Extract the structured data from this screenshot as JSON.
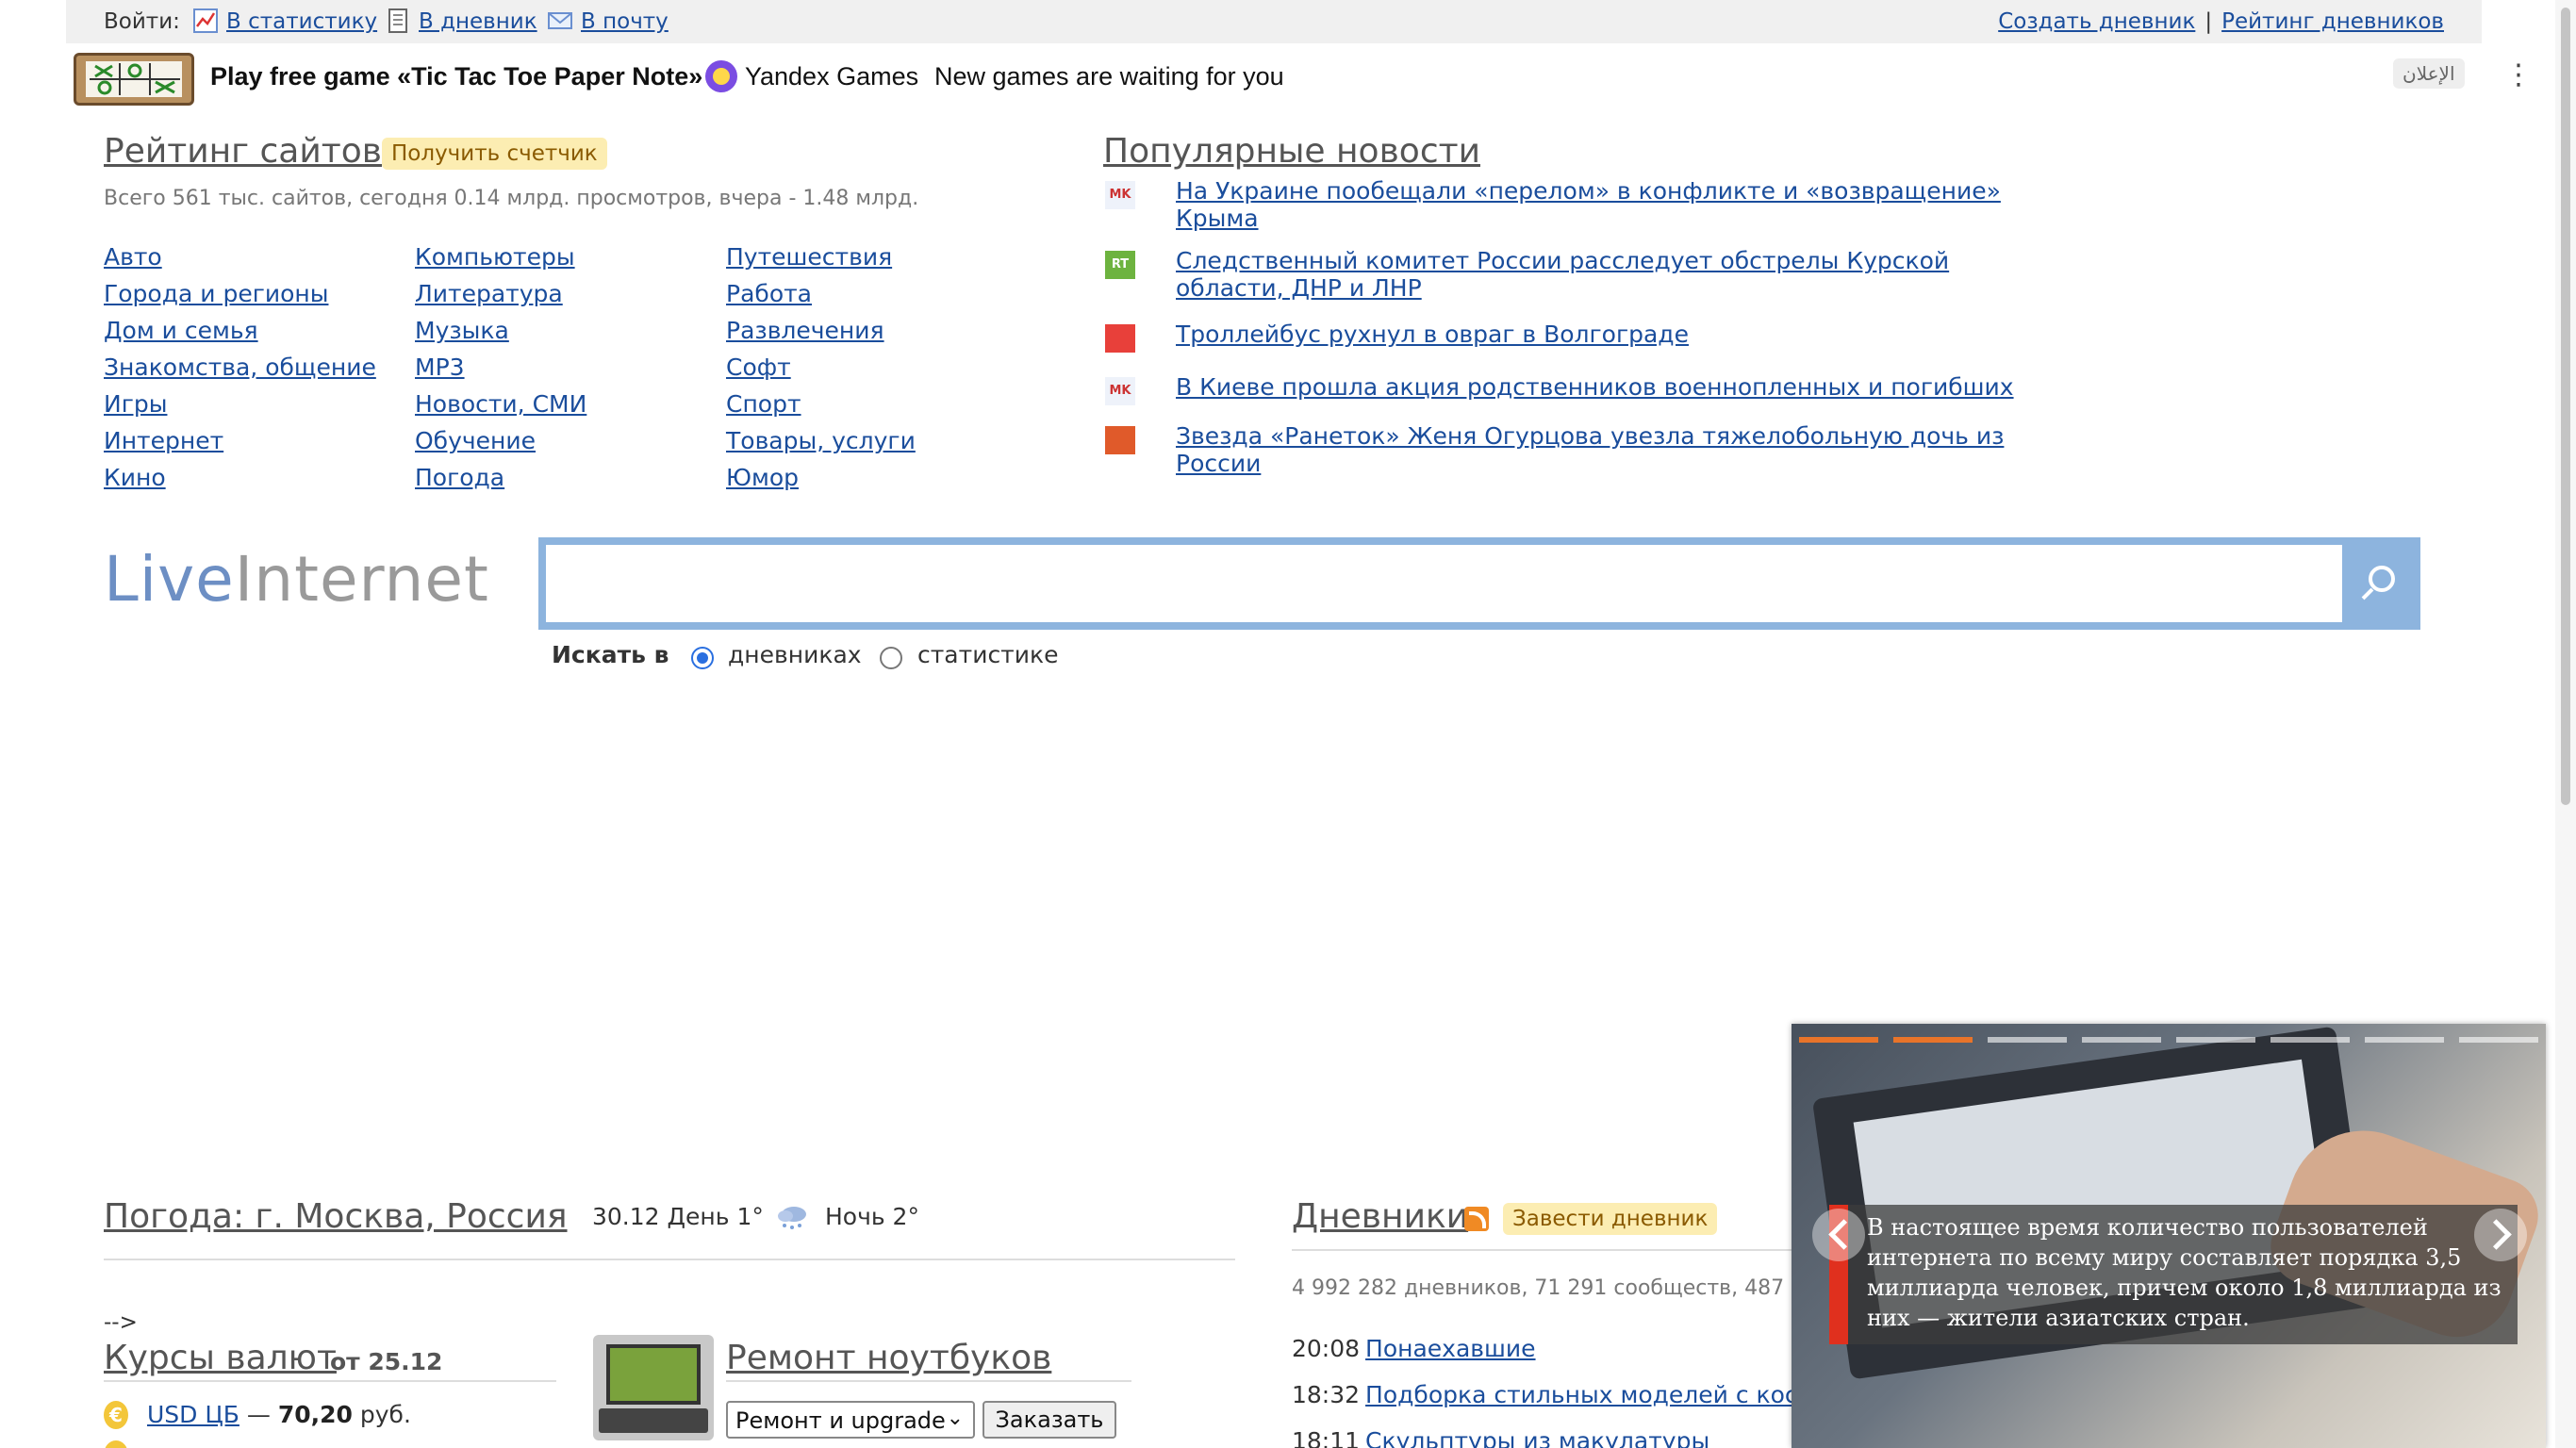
{
  "topbar": {
    "login_label": "Войти:",
    "links": [
      {
        "label": "В статистику",
        "icon": "stats-icon"
      },
      {
        "label": "В дневник",
        "icon": "diary-icon"
      },
      {
        "label": "В почту",
        "icon": "mail-icon"
      }
    ],
    "right_links": [
      "Создать дневник",
      "Рейтинг дневников"
    ],
    "separator": "|"
  },
  "ad": {
    "title": "Play free game «Tic Tac Toe Paper Note»",
    "brand": "Yandex Games",
    "description": "New games are waiting for you",
    "label": "الإعلان",
    "more_icon": "⋮"
  },
  "rating": {
    "title": "Рейтинг сайтов",
    "badge": "Получить счетчик",
    "stats": "Всего 561 тыс. сайтов, сегодня 0.14 млрд. просмотров, вчера - 1.48 млрд.",
    "categories": [
      [
        "Авто",
        "Города и регионы",
        "Дом и семья",
        "Знакомства, общение",
        "Игры",
        "Интернет",
        "Кино"
      ],
      [
        "Компьютеры",
        "Литература",
        "Музыка",
        "MP3",
        "Новости, СМИ",
        "Обучение",
        "Погода"
      ],
      [
        "Путешествия",
        "Работа",
        "Развлечения",
        "Софт",
        "Спорт",
        "Товары, услуги",
        "Юмор"
      ]
    ]
  },
  "news": {
    "title": "Популярные новости",
    "items": [
      {
        "text": "На Украине пообещали «перелом» в конфликте и «возвращение» Крыма",
        "source": "MK",
        "icon_color": "#d9534f"
      },
      {
        "text": "Следственный комитет России расследует обстрелы Курской области, ДНР и ЛНР",
        "source": "RT",
        "icon_color": "#6db33f"
      },
      {
        "text": "Троллейбус рухнул в овраг в Волгограде",
        "source": "",
        "icon_color": "#e8403a"
      },
      {
        "text": "В Киеве прошла акция родственников военнопленных и погибших",
        "source": "MK",
        "icon_color": "#d9534f"
      },
      {
        "text": "Звезда «Ранеток» Женя Огурцова увезла тяжелобольную дочь из России",
        "source": "",
        "icon_color": "#e05a2a"
      }
    ]
  },
  "search": {
    "logo_part1": "Live",
    "logo_part2": "Internet",
    "value": "",
    "search_in_label": "Искать в",
    "options": [
      "дневниках",
      "статистике"
    ],
    "selected": "дневниках"
  },
  "weather": {
    "title": "Погода: г. Москва, Россия",
    "day": "30.12 День 1°",
    "night": "Ночь 2°",
    "icon": "snow-cloud-icon"
  },
  "misc": {
    "arrow_text": "-->"
  },
  "currency": {
    "title": "Курсы валют",
    "date": "от 25.12",
    "rows": [
      {
        "name": "USD ЦБ",
        "separator": "—",
        "value": "70,20",
        "unit": "руб."
      }
    ]
  },
  "repair": {
    "title": "Ремонт ноутбуков",
    "select_value": "Ремонт и upgrade",
    "button": "Заказать"
  },
  "diaries": {
    "title": "Дневники",
    "badge": "Завести дневник",
    "stats": "4 992 282 дневников, 71 291 сообществ, 487 с",
    "rows": [
      {
        "time": "20:08",
        "link": "Понаехавшие"
      },
      {
        "time": "18:32",
        "link": "Подборка стильных моделей с косак"
      },
      {
        "time": "18:11",
        "link": "Скульптуры из макулатуры"
      }
    ]
  },
  "popup": {
    "caption": "В настоящее время количество пользователей интернета по всему миру составляет порядка 3,5 миллиарда человек, причем около 1,8 миллиарда из них — жители азиатских стран.",
    "bar_count": 8,
    "active_bars": 2,
    "accent": "#e8742a"
  }
}
